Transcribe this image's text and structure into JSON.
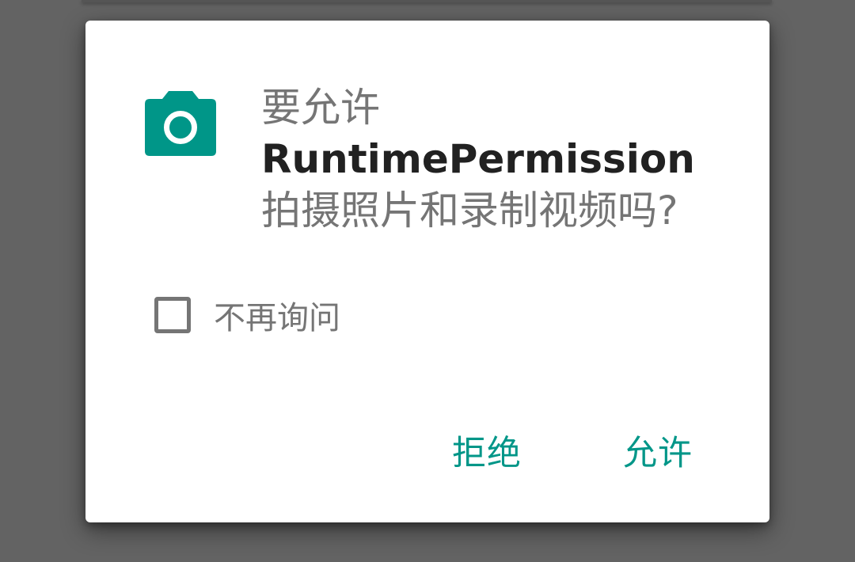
{
  "dialog": {
    "icon": "camera-icon",
    "message_prefix": "要允许",
    "app_name": "RuntimePermission",
    "message_suffix": "拍摄照片和录制视频吗?",
    "dont_ask_label": "不再询问",
    "dont_ask_checked": false,
    "deny_label": "拒绝",
    "allow_label": "允许"
  },
  "colors": {
    "accent": "#009688",
    "scrim": "#636363",
    "secondary_text": "#757575",
    "primary_text": "#212121"
  }
}
